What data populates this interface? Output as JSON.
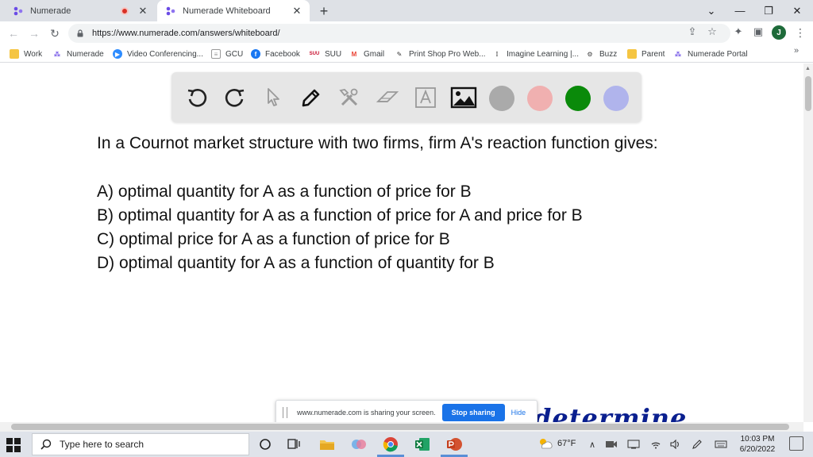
{
  "browser": {
    "tabs": [
      {
        "title": "Numerade",
        "active": false
      },
      {
        "title": "Numerade Whiteboard",
        "active": true
      }
    ],
    "new_tab": "+",
    "window_controls": [
      "⌄",
      "—",
      "❐",
      "✕"
    ],
    "address": "https://www.numerade.com/answers/whiteboard/",
    "profile_initial": "J"
  },
  "bookmarks": [
    {
      "label": "Work",
      "icon": "folder-icon",
      "color": "#f5c542"
    },
    {
      "label": "Numerade",
      "icon": "numerade-icon",
      "color": "#6b4ce6"
    },
    {
      "label": "Video Conferencing...",
      "icon": "video-icon",
      "color": "#2d8cff"
    },
    {
      "label": "GCU",
      "icon": "document-icon",
      "color": "#7a7a7a"
    },
    {
      "label": "Facebook",
      "icon": "facebook-icon",
      "color": "#1877f2"
    },
    {
      "label": "SUU",
      "icon": "suu-icon",
      "color": "#c8102e"
    },
    {
      "label": "Gmail",
      "icon": "gmail-icon",
      "color": "#ea4335"
    },
    {
      "label": "Print Shop Pro Web...",
      "icon": "print-icon",
      "color": "#333333"
    },
    {
      "label": "Imagine Learning |...",
      "icon": "imagine-icon",
      "color": "#222222"
    },
    {
      "label": "Buzz",
      "icon": "buzz-icon",
      "color": "#444444"
    },
    {
      "label": "Parent",
      "icon": "folder-icon",
      "color": "#f5c542"
    },
    {
      "label": "Numerade Portal",
      "icon": "numerade-icon",
      "color": "#6b4ce6"
    }
  ],
  "bookmarks_overflow": "»",
  "whiteboard": {
    "swatches": [
      "#aaaaaa",
      "#f0b0b0",
      "#0a8a0a",
      "#b0b4ec"
    ]
  },
  "question": {
    "text": "In a Cournot market structure with two firms, firm A's reaction function gives:",
    "options": [
      "A) optimal quantity for A as a function of price for B",
      "B) optimal quantity for A as a function of price for A and price for B",
      "C) optimal price for A as a function of price for B",
      "D) optimal quantity for A as a function of quantity for B"
    ]
  },
  "handwriting": "determine",
  "share_bar": {
    "message": "www.numerade.com is sharing your screen.",
    "stop_label": "Stop sharing",
    "hide_label": "Hide"
  },
  "taskbar": {
    "search_placeholder": "Type here to search",
    "weather": "67°F",
    "time": "10:03 PM",
    "date": "6/20/2022"
  }
}
